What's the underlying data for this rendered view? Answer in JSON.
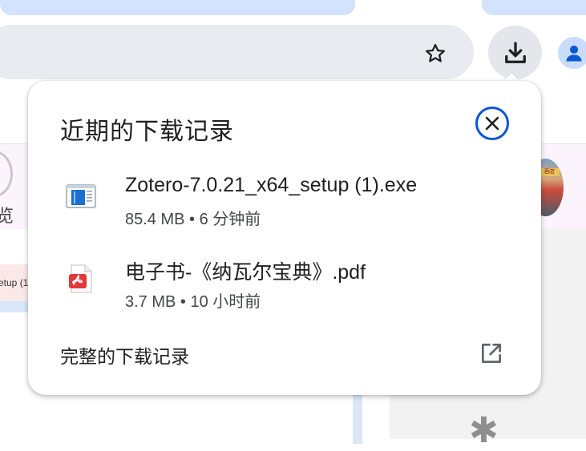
{
  "bubble": {
    "title": "近期的下载记录",
    "close_icon": "close-circle-icon",
    "items": [
      {
        "name": "Zotero-7.0.21_x64_setup (1).exe",
        "meta": "85.4 MB • 6 分钟前",
        "icon": "exe-file-icon"
      },
      {
        "name": "电子书-《纳瓦尔宝典》.pdf",
        "meta": "3.7 MB • 10 小时前",
        "icon": "pdf-file-icon"
      }
    ],
    "full_history_label": "完整的下载记录",
    "open_icon": "open-in-new-icon"
  },
  "toolbar": {
    "star_icon": "star-outline-icon",
    "download_icon": "download-icon",
    "avatar_icon": "person-icon"
  },
  "background": {
    "left_partial_char": "览",
    "left_partial_row_text": "etup (1)",
    "thumb_sign": "酒店"
  },
  "colors": {
    "accent": "#0b57d0",
    "tab": "#d3e3fd",
    "omnibox": "#e9ebf0",
    "pdf_red": "#e0393a"
  }
}
